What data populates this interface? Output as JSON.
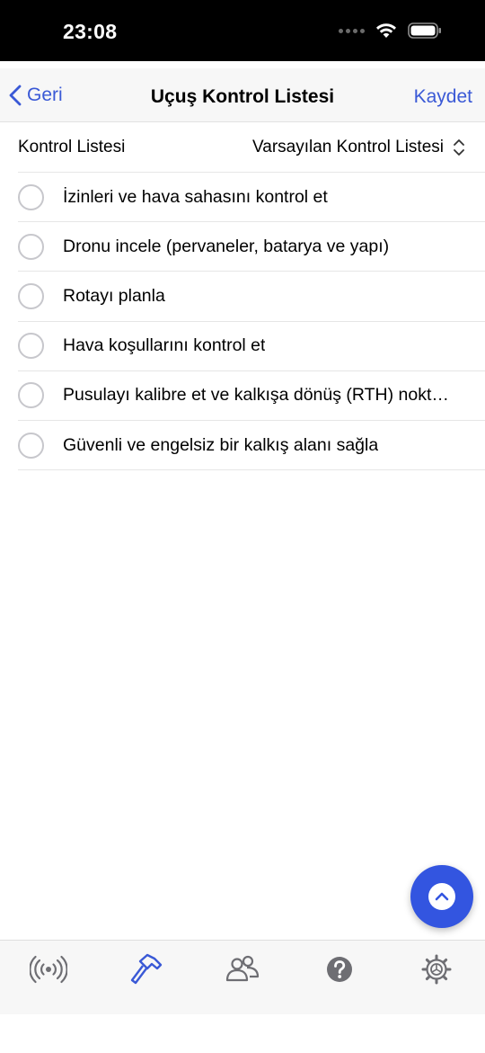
{
  "status_bar": {
    "time": "23:08"
  },
  "nav": {
    "back_label": "Geri",
    "title": "Uçuş Kontrol Listesi",
    "save_label": "Kaydet"
  },
  "picker": {
    "label": "Kontrol Listesi",
    "value": "Varsayılan Kontrol Listesi"
  },
  "checklist": {
    "items": [
      {
        "text": "İzinleri ve hava sahasını kontrol et",
        "checked": false
      },
      {
        "text": "Dronu incele (pervaneler, batarya ve yapı)",
        "checked": false
      },
      {
        "text": "Rotayı planla",
        "checked": false
      },
      {
        "text": "Hava koşullarını kontrol et",
        "checked": false
      },
      {
        "text": "Pusulayı kalibre et ve kalkışa dönüş (RTH) noktasını ayarla",
        "checked": false
      },
      {
        "text": "Güvenli ve engelsiz bir kalkış alanı sağla",
        "checked": false
      }
    ]
  },
  "tabs": [
    {
      "icon": "broadcast-icon",
      "active": false
    },
    {
      "icon": "hammer-icon",
      "active": true
    },
    {
      "icon": "people-icon",
      "active": false
    },
    {
      "icon": "help-icon",
      "active": false
    },
    {
      "icon": "gear-icon",
      "active": false
    }
  ],
  "colors": {
    "accent": "#3a59d6",
    "fab": "#3355e0",
    "inactive_icon": "#6e6e73",
    "separator": "#e6e6e6"
  }
}
